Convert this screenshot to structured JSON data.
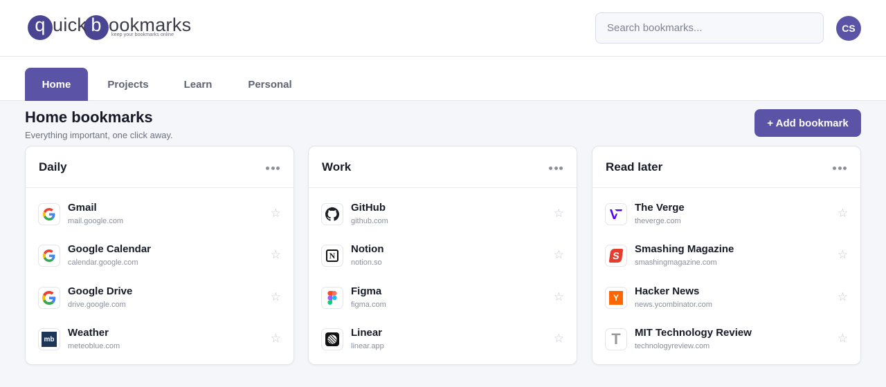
{
  "logo": {
    "letter_q": "q",
    "part_uick": "uick",
    "letter_b": "b",
    "part_ookmarks": "ookmarks",
    "tagline": "keep your bookmarks online"
  },
  "search": {
    "placeholder": "Search bookmarks..."
  },
  "user": {
    "initials": "CS"
  },
  "tabs": [
    {
      "label": "Home",
      "active": true
    },
    {
      "label": "Projects",
      "active": false
    },
    {
      "label": "Learn",
      "active": false
    },
    {
      "label": "Personal",
      "active": false
    }
  ],
  "page": {
    "title": "Home bookmarks",
    "subtitle": "Everything important, one click away.",
    "add_button": "+ Add bookmark"
  },
  "star_glyph": "☆",
  "colors": {
    "accent": "#5b54a6",
    "page_bg": "#f5f6fa"
  },
  "groups": [
    {
      "title": "Daily",
      "bookmarks": [
        {
          "name": "Gmail",
          "url": "mail.google.com",
          "icon": "google-icon"
        },
        {
          "name": "Google Calendar",
          "url": "calendar.google.com",
          "icon": "google-icon"
        },
        {
          "name": "Google Drive",
          "url": "drive.google.com",
          "icon": "google-icon"
        },
        {
          "name": "Weather",
          "url": "meteoblue.com",
          "icon": "meteoblue-icon",
          "icon_text": "mb"
        }
      ]
    },
    {
      "title": "Work",
      "bookmarks": [
        {
          "name": "GitHub",
          "url": "github.com",
          "icon": "github-icon"
        },
        {
          "name": "Notion",
          "url": "notion.so",
          "icon": "notion-icon",
          "icon_text": "N"
        },
        {
          "name": "Figma",
          "url": "figma.com",
          "icon": "figma-icon"
        },
        {
          "name": "Linear",
          "url": "linear.app",
          "icon": "linear-icon"
        }
      ]
    },
    {
      "title": "Read later",
      "bookmarks": [
        {
          "name": "The Verge",
          "url": "theverge.com",
          "icon": "verge-icon"
        },
        {
          "name": "Smashing Magazine",
          "url": "smashingmagazine.com",
          "icon": "smashing-icon",
          "icon_text": "S"
        },
        {
          "name": "Hacker News",
          "url": "news.ycombinator.com",
          "icon": "hacker-news-icon",
          "icon_text": "Y"
        },
        {
          "name": "MIT Technology Review",
          "url": "technologyreview.com",
          "icon": "mit-tr-icon",
          "icon_text": "T"
        }
      ]
    }
  ]
}
